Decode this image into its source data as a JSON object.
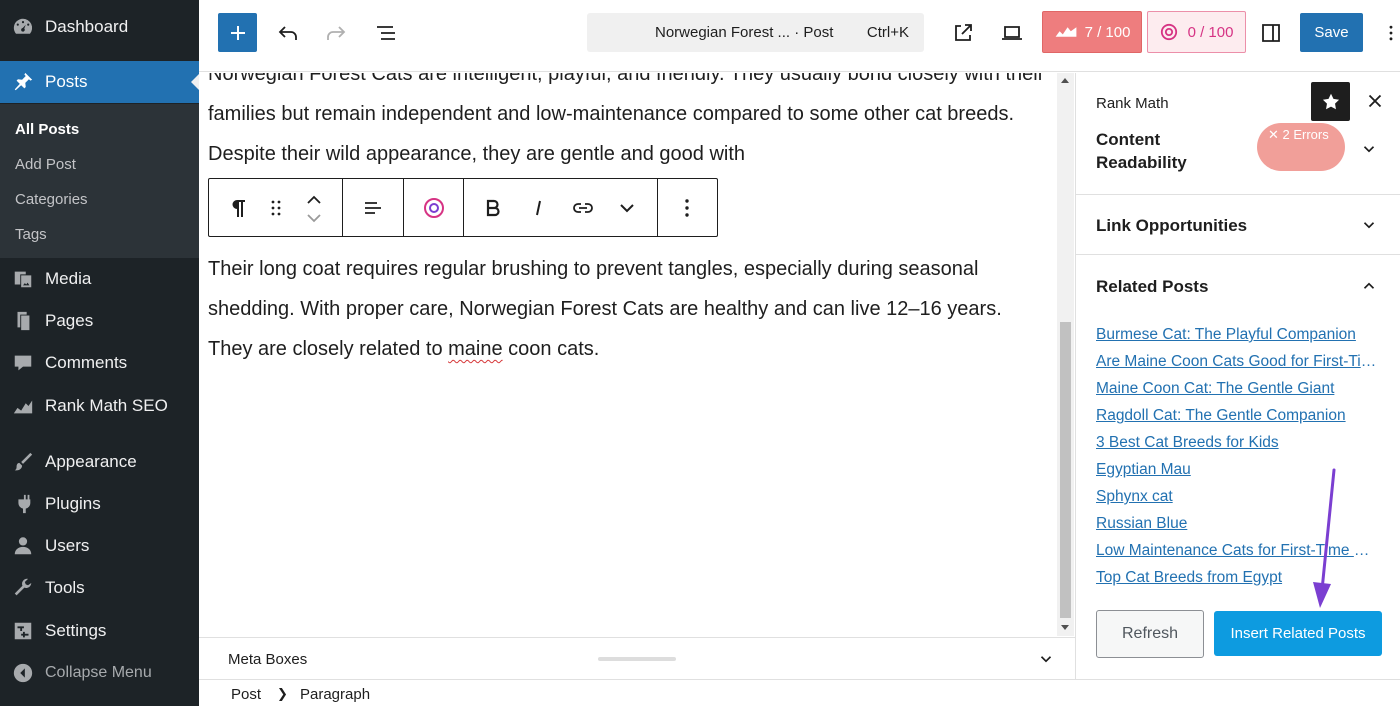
{
  "admin_menu": {
    "items": [
      {
        "label": "Dashboard",
        "icon": "dashboard-icon"
      },
      {
        "label": "Posts",
        "icon": "pin-icon"
      },
      {
        "label": "Media",
        "icon": "media-icon"
      },
      {
        "label": "Pages",
        "icon": "pages-icon"
      },
      {
        "label": "Comments",
        "icon": "comments-icon"
      },
      {
        "label": "Rank Math SEO",
        "icon": "rank-math-icon"
      },
      {
        "label": "Appearance",
        "icon": "paintbrush-icon"
      },
      {
        "label": "Plugins",
        "icon": "plugin-icon"
      },
      {
        "label": "Users",
        "icon": "users-icon"
      },
      {
        "label": "Tools",
        "icon": "wrench-icon"
      },
      {
        "label": "Settings",
        "icon": "settings-icon"
      }
    ],
    "posts_submenu": [
      "All Posts",
      "Add Post",
      "Categories",
      "Tags"
    ],
    "collapse_label": "Collapse Menu",
    "active_item": "Posts",
    "current_submenu": "All Posts"
  },
  "top_toolbar": {
    "command_title": "Norwegian Forest ... · Post",
    "command_shortcut": "Ctrl+K",
    "seo_score": "7 / 100",
    "content_ai_score": "0 / 100",
    "save_label": "Save"
  },
  "editor": {
    "para1": "Norwegian Forest Cats are intelligent, playful, and friendly. They usually bond closely with their families but remain independent and low-maintenance compared to some other cat breeds. Despite their wild appearance, they are gentle and good with",
    "para2_before": "Their long coat requires regular brushing to prevent tangles, especially during seasonal shedding. With proper care, Norwegian Forest Cats are healthy and can live 12–16 years. They are closely related to ",
    "para2_misspelled": "maine",
    "para2_after": " coon cats."
  },
  "meta_boxes_label": "Meta Boxes",
  "breadcrumb": [
    "Post",
    "Paragraph"
  ],
  "rank_math_panel": {
    "title": "Rank Math",
    "readability_title": "Content Readability",
    "readability_badge": "✕ 2 Errors",
    "link_opportunities_title": "Link Opportunities",
    "related_posts_title": "Related Posts",
    "related_posts": [
      "Burmese Cat: The Playful Companion",
      "Are Maine Coon Cats Good for First-Time Owners?",
      "Maine Coon Cat: The Gentle Giant",
      "Ragdoll Cat: The Gentle Companion",
      "3 Best Cat Breeds for Kids",
      "Egyptian Mau",
      "Sphynx cat",
      "Russian Blue",
      "Low Maintenance Cats for First-Time Owners",
      "Top Cat Breeds from Egypt"
    ],
    "refresh_label": "Refresh",
    "insert_label": "Insert Related Posts"
  },
  "colors": {
    "admin_bg": "#1d2327",
    "accent": "#2271b1",
    "seo_score_bg": "#ee7d7e",
    "insert_btn": "#0d9be0",
    "annotation_arrow": "#7b3fd1"
  }
}
